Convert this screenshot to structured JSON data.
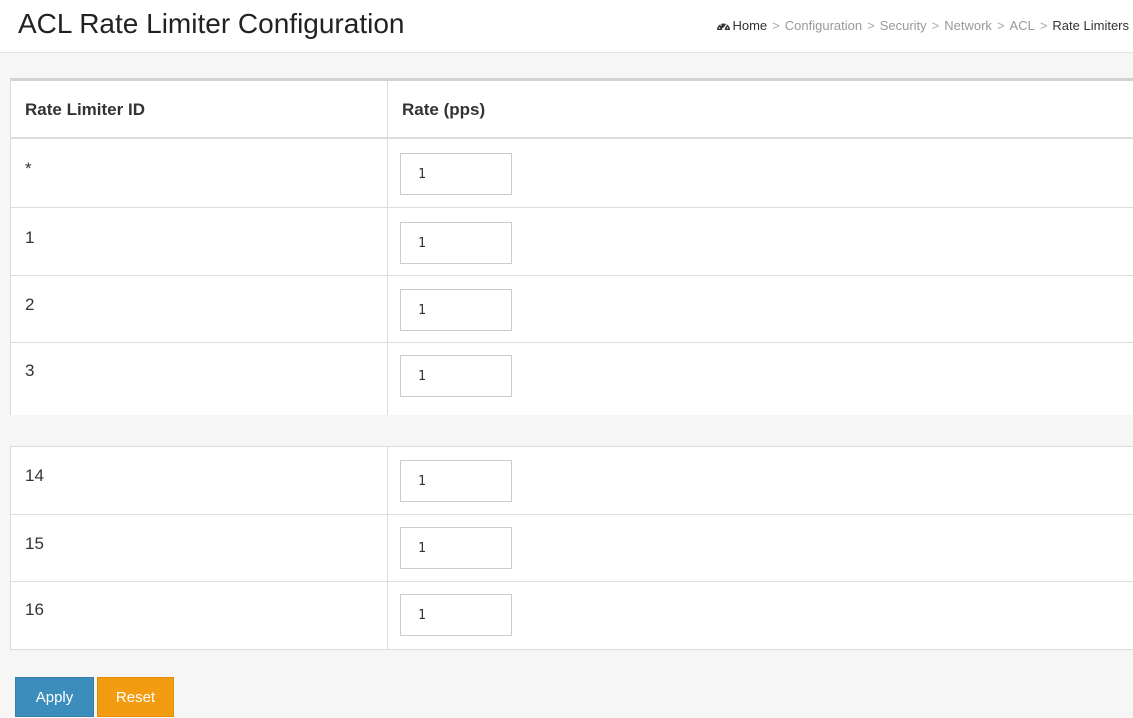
{
  "header": {
    "title": "ACL Rate Limiter Configuration",
    "breadcrumb": [
      {
        "label": "Home",
        "icon": "dashboard-icon"
      },
      {
        "label": "Configuration"
      },
      {
        "label": "Security"
      },
      {
        "label": "Network"
      },
      {
        "label": "ACL"
      },
      {
        "label": "Rate Limiters"
      }
    ],
    "breadcrumb_separator": ">"
  },
  "table": {
    "columns": [
      "Rate Limiter ID",
      "Rate (pps)"
    ],
    "rows_top": [
      {
        "id": "*",
        "rate": "1"
      },
      {
        "id": "1",
        "rate": "1"
      },
      {
        "id": "2",
        "rate": "1"
      },
      {
        "id": "3",
        "rate": "1"
      }
    ],
    "rows_bottom": [
      {
        "id": "14",
        "rate": "1"
      },
      {
        "id": "15",
        "rate": "1"
      },
      {
        "id": "16",
        "rate": "1"
      }
    ]
  },
  "buttons": {
    "apply": "Apply",
    "reset": "Reset"
  },
  "colors": {
    "apply": "#3c8dbc",
    "reset": "#f39c12"
  }
}
